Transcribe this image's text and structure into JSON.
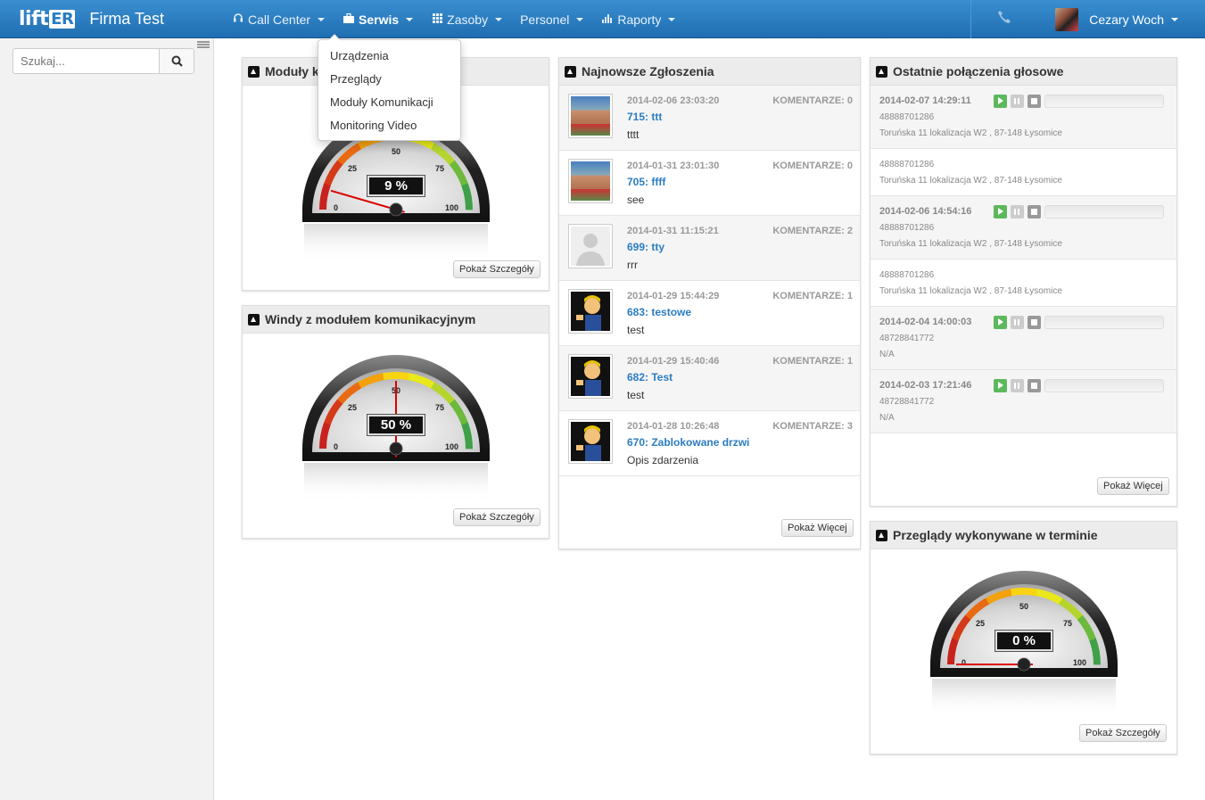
{
  "app": {
    "company": "Firma Test",
    "logo_left": "lift",
    "logo_right": "ER"
  },
  "nav": {
    "items": [
      {
        "label": "Call Center",
        "icon": "headphones-icon"
      },
      {
        "label": "Serwis",
        "icon": "briefcase-icon",
        "active": true
      },
      {
        "label": "Zasoby",
        "icon": "grid-icon"
      },
      {
        "label": "Personel",
        "icon": ""
      },
      {
        "label": "Raporty",
        "icon": "bar-chart-icon"
      }
    ],
    "user": "Cezary Woch"
  },
  "dropdown": {
    "items": [
      "Urządzenia",
      "Przeglądy",
      "Moduły Komunikacji",
      "Monitoring Video"
    ]
  },
  "search": {
    "placeholder": "Szukaj..."
  },
  "gauges": [
    {
      "title": "Moduły k",
      "value": 9,
      "label": "9 %",
      "button": "Pokaż Szczegóły",
      "ticks": [
        "0",
        "25",
        "50",
        "75",
        "100"
      ]
    },
    {
      "title": "Windy z modułem komunikacyjnym",
      "value": 50,
      "label": "50 %",
      "button": "Pokaż Szczegóły",
      "ticks": [
        "0",
        "25",
        "50",
        "75",
        "100"
      ]
    },
    {
      "title": "Przeglądy wykonywane w terminie",
      "value": 0,
      "label": "0 %",
      "button": "Pokaż Szczegóły",
      "ticks": [
        "0",
        "25",
        "50",
        "75",
        "100"
      ]
    }
  ],
  "tickets": {
    "title": "Najnowsze Zgłoszenia",
    "button": "Pokaż Więcej",
    "items": [
      {
        "date": "2014-02-06 23:03:20",
        "comments": "KOMENTARZE: 0",
        "title": "715: ttt",
        "desc": "tttt",
        "avatar": "photo"
      },
      {
        "date": "2014-01-31 23:01:30",
        "comments": "KOMENTARZE: 0",
        "title": "705: ffff",
        "desc": "see",
        "avatar": "photo"
      },
      {
        "date": "2014-01-31 11:15:21",
        "comments": "KOMENTARZE: 2",
        "title": "699: tty",
        "desc": "rrr",
        "avatar": "placeholder"
      },
      {
        "date": "2014-01-29 15:44:29",
        "comments": "KOMENTARZE: 1",
        "title": "683: testowe",
        "desc": "test",
        "avatar": "cartoon"
      },
      {
        "date": "2014-01-29 15:40:46",
        "comments": "KOMENTARZE: 1",
        "title": "682: Test",
        "desc": "test",
        "avatar": "cartoon"
      },
      {
        "date": "2014-01-28 10:26:48",
        "comments": "KOMENTARZE: 3",
        "title": "670: Zablokowane drzwi",
        "desc": "Opis zdarzenia",
        "avatar": "cartoon"
      }
    ]
  },
  "calls": {
    "title": "Ostatnie połączenia głosowe",
    "button": "Pokaż Więcej",
    "items": [
      {
        "date": "2014-02-07 14:29:11",
        "number": "48888701286",
        "address": "Toruńska 11 lokalizacja W2 , 87-148 Łysomice",
        "player": true
      },
      {
        "date": "",
        "number": "48888701286",
        "address": "Toruńska 11 lokalizacja W2 , 87-148 Łysomice",
        "player": false
      },
      {
        "date": "2014-02-06 14:54:16",
        "number": "48888701286",
        "address": "Toruńska 11 lokalizacja W2 , 87-148 Łysomice",
        "player": true
      },
      {
        "date": "",
        "number": "48888701286",
        "address": "Toruńska 11 lokalizacja W2 , 87-148 Łysomice",
        "player": false
      },
      {
        "date": "2014-02-04 14:00:03",
        "number": "48728841772",
        "address": "N/A",
        "player": true
      },
      {
        "date": "2014-02-03 17:21:46",
        "number": "48728841772",
        "address": "N/A",
        "player": true
      }
    ]
  }
}
